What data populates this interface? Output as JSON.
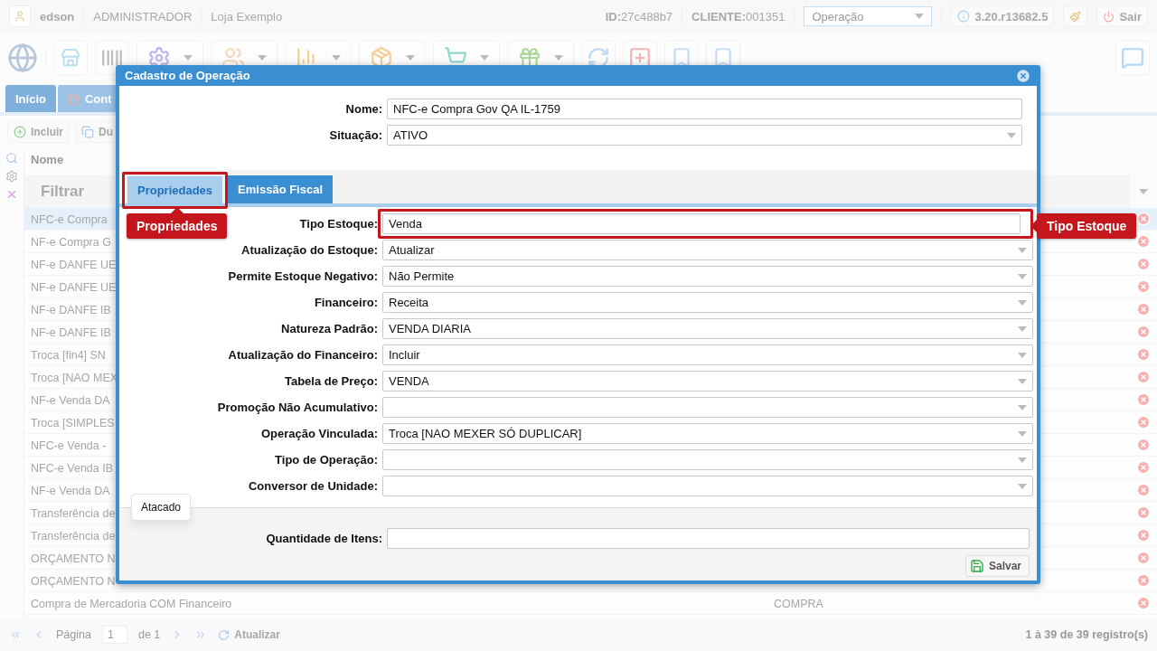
{
  "top_bar": {
    "user": "edson",
    "role": "ADMINISTRADOR",
    "store": "Loja Exemplo",
    "id_label": "ID:",
    "id": "27c488b7",
    "client_label": "CLIENTE:",
    "client": "001351",
    "module_select": "Operação",
    "version": "3.20.r13682.5",
    "logout": "Sair"
  },
  "tabs": [
    {
      "label": "Início",
      "selected": true
    },
    {
      "label": "Cont",
      "selected": false
    }
  ],
  "actions": [
    {
      "label": "Incluir",
      "kind": "add"
    },
    {
      "label": "Du",
      "kind": "copy"
    }
  ],
  "grid": {
    "column_1": "Nome",
    "filter_placeholder": "Filtrar",
    "rows": [
      {
        "name": "NFC-e Compra",
        "selected": true
      },
      {
        "name": "NF-e Compra G",
        "selected": false
      },
      {
        "name": "NF-e DANFE UE",
        "selected": false
      },
      {
        "name": "NF-e DANFE UE",
        "selected": false
      },
      {
        "name": "NF-e DANFE IB",
        "selected": false
      },
      {
        "name": "NF-e DANFE IB",
        "selected": false
      },
      {
        "name": "Troca [fin4] SN",
        "selected": false
      },
      {
        "name": "Troca [NAO MEX",
        "selected": false
      },
      {
        "name": "NF-e Venda DA",
        "selected": false
      },
      {
        "name": "Troca [SIMPLES",
        "selected": false
      },
      {
        "name": "NFC-e Venda -",
        "selected": false
      },
      {
        "name": "NFC-e Venda IB",
        "selected": false
      },
      {
        "name": "NF-e Venda DA",
        "selected": false
      },
      {
        "name": "Transferência de",
        "selected": false
      },
      {
        "name": "Transferência de",
        "selected": false
      },
      {
        "name": "ORÇAMENTO N",
        "selected": false
      },
      {
        "name": "ORÇAMENTO N",
        "selected": false
      },
      {
        "name": "Compra de Mercadoria COM Financeiro",
        "column_2": "COMPRA",
        "selected": false
      }
    ]
  },
  "pager": {
    "page_label": "Página",
    "page": "1",
    "of": "de 1",
    "refresh": "Atualizar",
    "summary": "1 à 39 de 39 registro(s)"
  },
  "dialog": {
    "title": "Cadastro de Operação",
    "header_fields": [
      {
        "label": "Nome:",
        "value": "NFC-e Compra Gov QA IL-1759",
        "kind": "text"
      },
      {
        "label": "Situação:",
        "value": "ATIVO",
        "kind": "select"
      }
    ],
    "tabs": [
      {
        "label": "Propriedades",
        "selected": true,
        "callout": "Propriedades"
      },
      {
        "label": "Emissão Fiscal",
        "selected": false
      }
    ],
    "fields": [
      {
        "label": "Tipo Estoque:",
        "value": "Venda",
        "kind": "text",
        "callout": "Tipo Estoque"
      },
      {
        "label": "Atualização do Estoque:",
        "value": "Atualizar",
        "kind": "select"
      },
      {
        "label": "Permite Estoque Negativo:",
        "value": "Não Permite",
        "kind": "select"
      },
      {
        "label": "Financeiro:",
        "value": "Receita",
        "kind": "select"
      },
      {
        "label": "Natureza Padrão:",
        "value": "VENDA DIARIA",
        "kind": "select"
      },
      {
        "label": "Atualização do Financeiro:",
        "value": "Incluir",
        "kind": "select"
      },
      {
        "label": "Tabela de Preço:",
        "value": "VENDA",
        "kind": "select"
      },
      {
        "label": "Promoção Não Acumulativo:",
        "kind": "select"
      },
      {
        "label": "Operação Vinculada:",
        "value": "Troca [NAO MEXER SÓ DUPLICAR]",
        "kind": "select"
      },
      {
        "label": "Tipo de Operação:",
        "kind": "select"
      },
      {
        "label": "Conversor de Unidade:",
        "kind": "select"
      }
    ],
    "group": {
      "legend": "Atacado",
      "fields": [
        {
          "label": "Quantidade de Itens:",
          "kind": "text"
        }
      ]
    },
    "save": "Salvar"
  }
}
